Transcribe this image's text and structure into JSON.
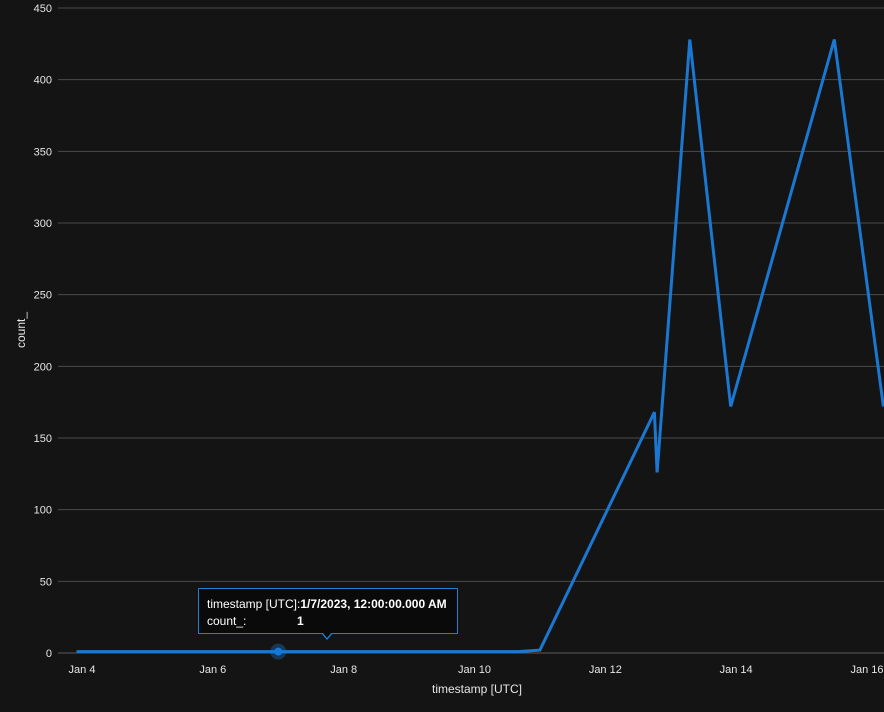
{
  "chart_data": {
    "type": "line",
    "xlabel": "timestamp [UTC]",
    "ylabel": "count_",
    "ylim": [
      0,
      450
    ],
    "y_ticks": [
      0,
      50,
      100,
      150,
      200,
      250,
      300,
      350,
      400,
      450
    ],
    "x_ticks": [
      "Jan 4",
      "Jan 6",
      "Jan 8",
      "Jan 10",
      "Jan 12",
      "Jan 14",
      "Jan 16"
    ],
    "x_tick_days": [
      4,
      6,
      8,
      10,
      12,
      14,
      16
    ],
    "grid": "horizontal",
    "series": [
      {
        "color": "#1a78d2",
        "points": [
          {
            "x": "2023-01-03 22:00",
            "y": 1
          },
          {
            "x": "2023-01-07 00:00",
            "y": 1
          },
          {
            "x": "2023-01-10 16:00",
            "y": 1
          },
          {
            "x": "2023-01-11 00:00",
            "y": 2
          },
          {
            "x": "2023-01-12 18:00",
            "y": 168
          },
          {
            "x": "2023-01-12 19:00",
            "y": 126
          },
          {
            "x": "2023-01-13 07:00",
            "y": 428
          },
          {
            "x": "2023-01-13 22:00",
            "y": 172
          },
          {
            "x": "2023-01-15 12:00",
            "y": 428
          },
          {
            "x": "2023-01-16 06:00",
            "y": 172
          }
        ]
      }
    ],
    "highlight": {
      "x": "2023-01-07 00:00",
      "y": 1
    }
  },
  "tooltip": {
    "timestamp_key": "timestamp [UTC]:",
    "timestamp_value": "1/7/2023, 12:00:00.000 AM",
    "count_key": "count_:",
    "count_value": "1"
  }
}
